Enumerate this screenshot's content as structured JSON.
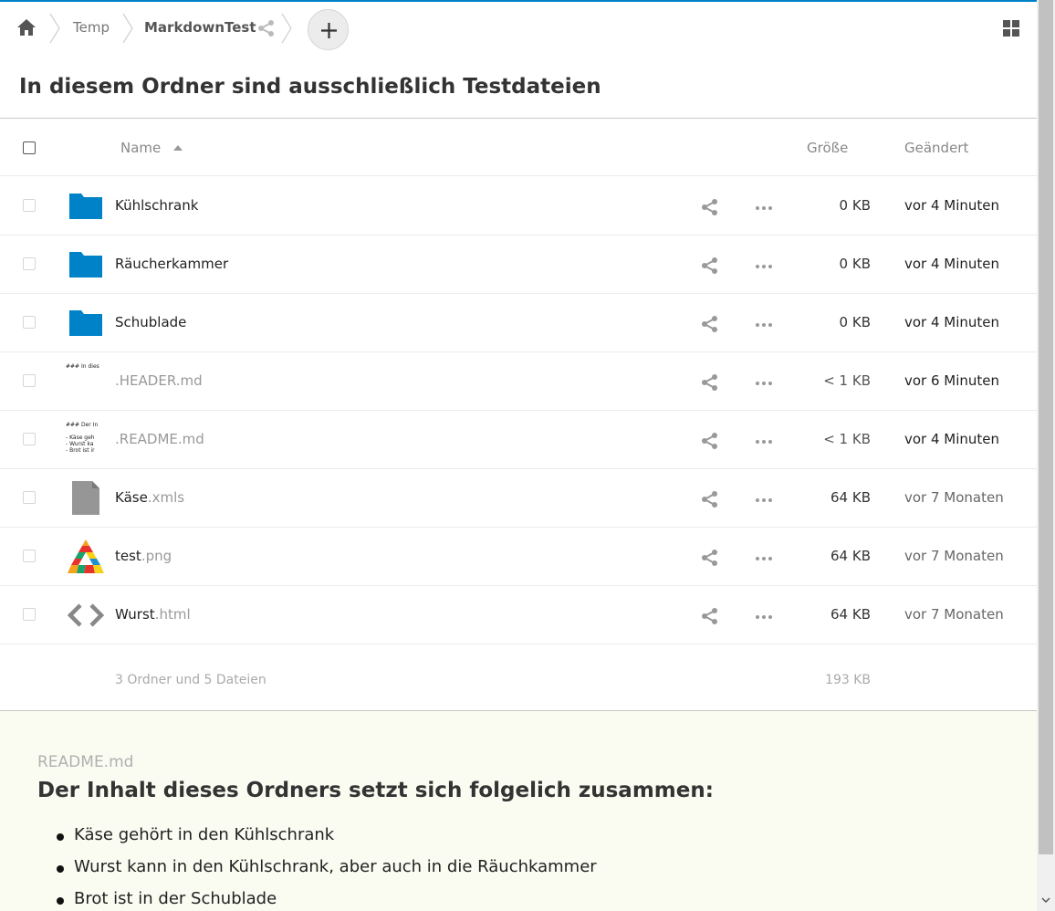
{
  "breadcrumb": {
    "items": [
      "Temp",
      "MarkdownTest"
    ]
  },
  "header": {
    "title": "In diesem Ordner sind ausschließlich Testdateien"
  },
  "table": {
    "columns": {
      "name": "Name",
      "size": "Größe",
      "modified": "Geändert"
    },
    "rows": [
      {
        "type": "folder",
        "base": "Kühlschrank",
        "ext": "",
        "size": "0 KB",
        "modified": "vor 4 Minuten"
      },
      {
        "type": "folder",
        "base": "Räucherkammer",
        "ext": "",
        "size": "0 KB",
        "modified": "vor 4 Minuten"
      },
      {
        "type": "folder",
        "base": "Schublade",
        "ext": "",
        "size": "0 KB",
        "modified": "vor 4 Minuten"
      },
      {
        "type": "md-preview",
        "base": "",
        "ext": ".HEADER.md",
        "size": "< 1 KB",
        "modified": "vor 6 Minuten",
        "preview": [
          "### In dies"
        ]
      },
      {
        "type": "md-preview",
        "base": "",
        "ext": ".README.md",
        "size": "< 1 KB",
        "modified": "vor 4 Minuten",
        "preview": [
          "### Der In",
          "",
          "- Käse geh",
          "- Wurst ka",
          "- Brot ist ir"
        ]
      },
      {
        "type": "file",
        "base": "Käse",
        "ext": ".xmls",
        "size": "64 KB",
        "modified": "vor 7 Monaten"
      },
      {
        "type": "image",
        "base": "test",
        "ext": ".png",
        "size": "64 KB",
        "modified": "vor 7 Monaten"
      },
      {
        "type": "code",
        "base": "Wurst",
        "ext": ".html",
        "size": "64 KB",
        "modified": "vor 7 Monaten"
      }
    ],
    "summary": {
      "text": "3 Ordner und 5 Dateien",
      "size": "193 KB"
    }
  },
  "readme": {
    "filename": "README.md",
    "heading": "Der Inhalt dieses Ordners setzt sich folgelich zusammen:",
    "items": [
      "Käse gehört in den Kühlschrank",
      "Wurst kann in den Kühlschrank, aber auch in die Räuchkammer",
      "Brot ist in der Schublade"
    ]
  },
  "colors": {
    "accent": "#0082c9",
    "folder": "#0082c9",
    "readme_bg": "#fafcf1"
  }
}
